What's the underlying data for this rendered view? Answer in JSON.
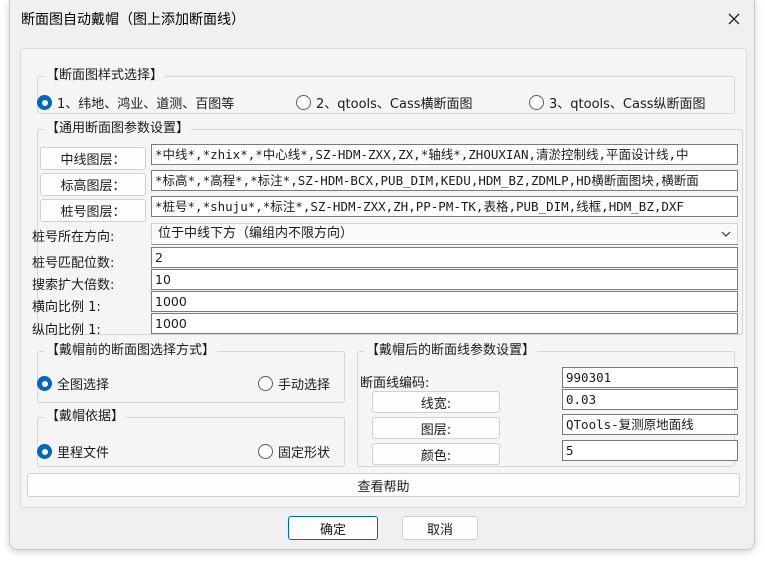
{
  "window": {
    "title": "断面图自动戴帽（图上添加断面线）"
  },
  "style_section": {
    "title": "【断面图样式选择】",
    "options": [
      {
        "label": "1、纬地、鸿业、道测、百图等",
        "checked": true
      },
      {
        "label": "2、qtools、Cass横断面图",
        "checked": false
      },
      {
        "label": "3、qtools、Cass纵断面图",
        "checked": false
      }
    ]
  },
  "common_section": {
    "title": "【通用断面图参数设置】",
    "centerline_layer": {
      "button": "中线图层：",
      "value": "*中线*,*zhix*,*中心线*,SZ-HDM-ZXX,ZX,*轴线*,ZHOUXIAN,清淤控制线,平面设计线,中"
    },
    "elevation_layer": {
      "button": "标高图层：",
      "value": "*标高*,*高程*,*标注*,SZ-HDM-BCX,PUB_DIM,KEDU,HDM_BZ,ZDMLP,HD横断面图块,横断面"
    },
    "station_layer": {
      "button": "桩号图层：",
      "value": "*桩号*,*shuju*,*标注*,SZ-HDM-ZXX,ZH,PP-PM-TK,表格,PUB_DIM,线框,HDM_BZ,DXF"
    },
    "station_direction": {
      "label": "桩号所在方向:",
      "value": "位于中线下方（编组内不限方向）"
    },
    "match_digits": {
      "label": "桩号匹配位数:",
      "value": "2"
    },
    "search_factor": {
      "label": "搜索扩大倍数:",
      "value": "10"
    },
    "h_scale": {
      "label": "横向比例 1:",
      "value": "1000"
    },
    "v_scale": {
      "label": "纵向比例 1:",
      "value": "1000"
    }
  },
  "select_mode_section": {
    "title": "【戴帽前的断面图选择方式】",
    "options": [
      {
        "label": "全图选择",
        "checked": true
      },
      {
        "label": "手动选择",
        "checked": false
      }
    ]
  },
  "basis_section": {
    "title": "【戴帽依据】",
    "options": [
      {
        "label": "里程文件",
        "checked": true
      },
      {
        "label": "固定形状",
        "checked": false
      }
    ]
  },
  "line_section": {
    "title": "【戴帽后的断面线参数设置】",
    "code": {
      "label": "断面线编码:",
      "value": "990301"
    },
    "width": {
      "button": "线宽:",
      "value": "0.03"
    },
    "layer": {
      "button": "图层:",
      "value": "QTools-复测原地面线"
    },
    "color": {
      "button": "颜色:",
      "value": "5"
    }
  },
  "help_button": "查看帮助",
  "ok_button": "确定",
  "cancel_button": "取消",
  "colors": {
    "accent": "#0067c0",
    "window_bg": "#f0f0f0",
    "border": "#7a7a7a"
  }
}
